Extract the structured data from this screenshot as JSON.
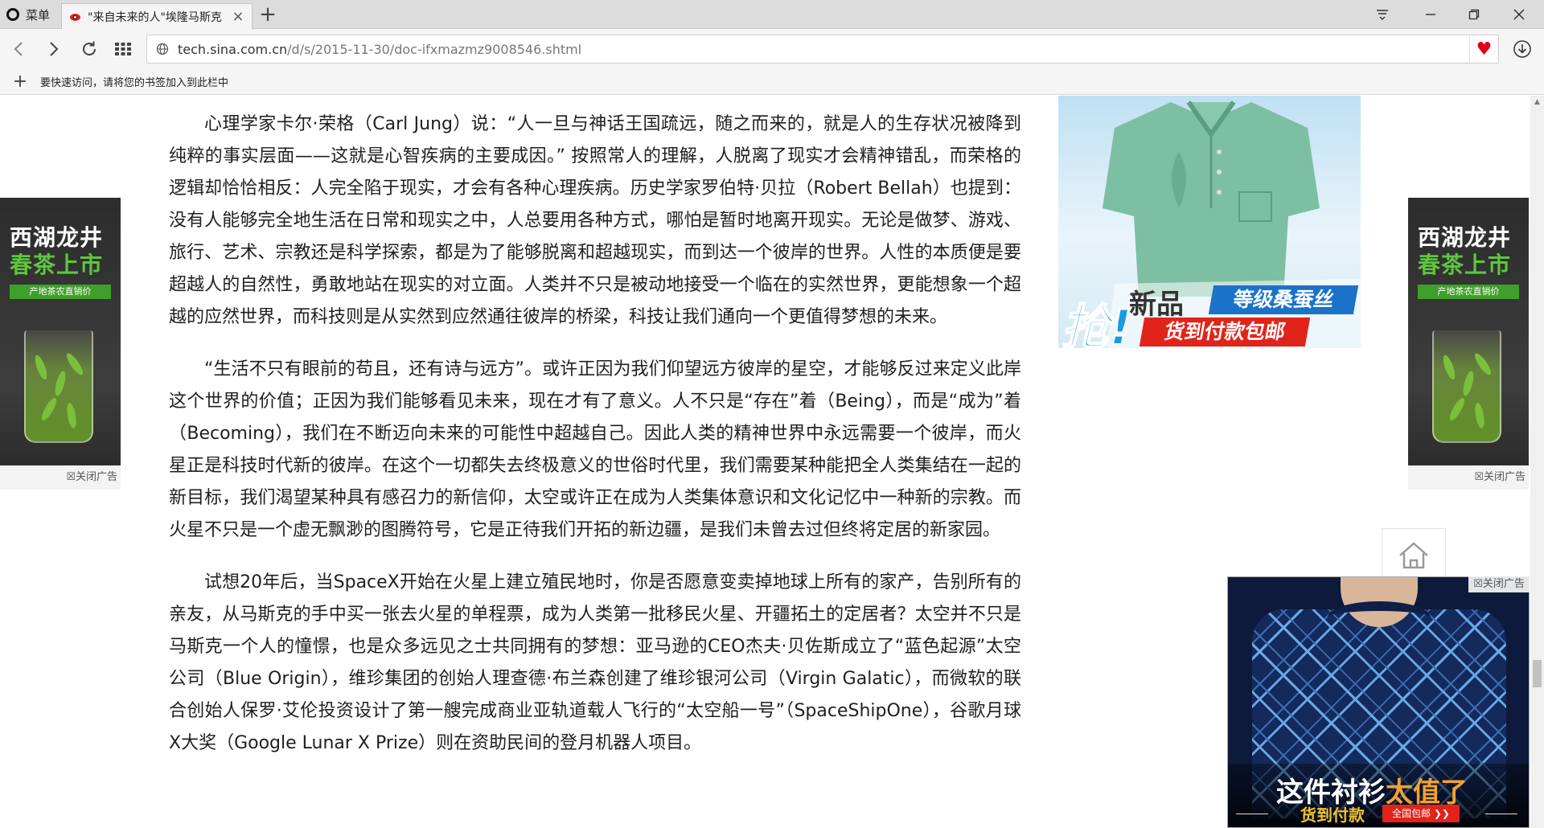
{
  "browser": {
    "menu_label": "菜单",
    "tab_title": "\"来自未来的人\"埃隆马斯克",
    "url_host": "tech.sina.com.cn",
    "url_path": "/d/s/2015-11-30/doc-ifxmazmz9008546.shtml",
    "bookmarks_hint": "要快速访问，请将您的书签加入到此栏中",
    "accent_heart": "#e0001b"
  },
  "article": {
    "paragraphs": [
      "心理学家卡尔·荣格（Carl Jung）说：“人一旦与神话王国疏远，随之而来的，就是人的生存状况被降到纯粹的事实层面——这就是心智疾病的主要成因。” 按照常人的理解，人脱离了现实才会精神错乱，而荣格的逻辑却恰恰相反：人完全陷于现实，才会有各种心理疾病。历史学家罗伯特·贝拉（Robert Bellah）也提到：没有人能够完全地生活在日常和现实之中，人总要用各种方式，哪怕是暂时地离开现实。无论是做梦、游戏、旅行、艺术、宗教还是科学探索，都是为了能够脱离和超越现实，而到达一个彼岸的世界。人性的本质便是要超越人的自然性，勇敢地站在现实的对立面。人类并不只是被动地接受一个临在的实然世界，更能想象一个超越的应然世界，而科技则是从实然到应然通往彼岸的桥梁，科技让我们通向一个更值得梦想的未来。",
      "“生活不只有眼前的苟且，还有诗与远方”。或许正因为我们仰望远方彼岸的星空，才能够反过来定义此岸这个世界的价值；正因为我们能够看见未来，现在才有了意义。人不只是“存在”着（Being），而是“成为”着（Becoming），我们在不断迈向未来的可能性中超越自己。因此人类的精神世界中永远需要一个彼岸，而火星正是科技时代新的彼岸。在这个一切都失去终极意义的世俗时代里，我们需要某种能把全人类集结在一起的新目标，我们渴望某种具有感召力的新信仰，太空或许正在成为人类集体意识和文化记忆中一种新的宗教。而火星不只是一个虚无飘渺的图腾符号，它是正待我们开拓的新边疆，是我们未曾去过但终将定居的新家园。",
      "试想20年后，当SpaceX开始在火星上建立殖民地时，你是否愿意变卖掉地球上所有的家产，告别所有的亲友，从马斯克的手中买一张去火星的单程票，成为人类第一批移民火星、开疆拓土的定居者？太空并不只是马斯克一个人的憧憬，也是众多远见之士共同拥有的梦想：亚马逊的CEO杰夫·贝佐斯成立了“蓝色起源”太空公司（Blue Origin），维珍集团的创始人理查德·布兰森创建了维珍银河公司（Virgin Galatic），而微软的联合创始人保罗·艾伦投资设计了第一艘完成商业亚轨道载人飞行的“太空船一号”（SpaceShipOne），谷歌月球X大奖（Google Lunar X Prize）则在资助民间的登月机器人项目。"
    ]
  },
  "ads": {
    "couplet_title1": "西湖龙井",
    "couplet_title2": "春茶上市",
    "couplet_tag": "产地茶农直销价",
    "close_label": "关闭广告",
    "polo_qiang": "抢!",
    "polo_new": "新品",
    "polo_grade": "等级桑蚕丝",
    "polo_cod": "货到付款包邮",
    "shirt_line1_a": "这件衬衫",
    "shirt_line1_b": "太值了",
    "shirt_line2": "货到付款",
    "shirt_badge": "全国包邮 ❯❯"
  }
}
